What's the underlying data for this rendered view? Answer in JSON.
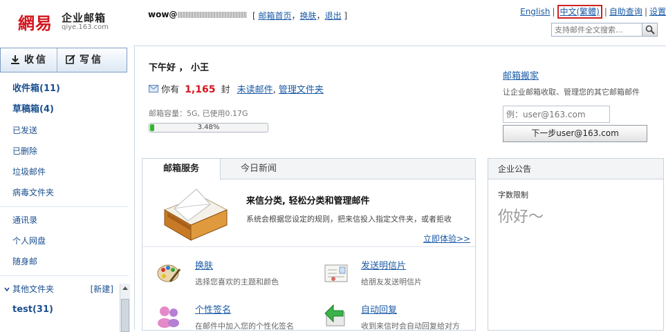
{
  "header": {
    "logo_mark": "網易",
    "logo_title": "企业邮箱",
    "logo_domain": "qiye.163.com",
    "user_prefix": "wow@",
    "top_links": [
      "邮箱首页",
      "换肤",
      "退出"
    ],
    "right_links": {
      "english": "English",
      "traditional": "中文(繁體)",
      "self_help": "自助查询",
      "settings": "设置"
    },
    "search_placeholder": "支持邮件全文搜索..."
  },
  "sidebar": {
    "receive_label": "收信",
    "write_label": "写信",
    "folders": [
      "收件箱(11)",
      "草稿箱(4)",
      "已发送",
      "已删除",
      "垃圾邮件",
      "病毒文件夹"
    ],
    "tools": [
      "通讯录",
      "个人网盘",
      "随身邮"
    ],
    "other_folders_label": "其他文件夹",
    "new_folder_label": "[新建]",
    "custom_folders": [
      "test(31)"
    ]
  },
  "main": {
    "greeting": "下午好 ， 小王",
    "unread_prefix": "你有",
    "unread_count": "1,165",
    "unread_unit": "封",
    "unread_link": "未读邮件",
    "manage_link": "管理文件夹",
    "storage_label": "邮箱容量：5G, 已使用0.17G",
    "storage_percent_text": "3.48%",
    "storage_fraction": 0.0348
  },
  "migration": {
    "title": "邮箱搬家",
    "desc": "让企业邮箱收取、管理您的其它邮箱邮件",
    "input_placeholder": "例：user@163.com",
    "next_button": "下一步user@163.com"
  },
  "service_panel": {
    "tabs": [
      "邮箱服务",
      "今日新闻"
    ],
    "feature_title": "来信分类, 轻松分类和管理邮件",
    "feature_desc": "系统会根据您设定的规则，把来信投入指定文件夹，或者拒收",
    "feature_link": "立即体验>>",
    "items": [
      {
        "title": "换肤",
        "desc": "选择您喜欢的主题和颜色",
        "icon": "palette-icon"
      },
      {
        "title": "发送明信片",
        "desc": "给朋友发送明信片",
        "icon": "postcard-icon"
      },
      {
        "title": "个性签名",
        "desc": "在邮件中加入您的个性化签名",
        "icon": "signature-icon"
      },
      {
        "title": "自动回复",
        "desc": "收到来信时会自动回复给对方",
        "icon": "auto-reply-icon"
      }
    ]
  },
  "notice_panel": {
    "title": "企业公告",
    "subtitle": "字数限制",
    "text": "你好～"
  },
  "colors": {
    "brand_red": "#d5151d",
    "link_blue": "#1a5aa6",
    "progress_green": "#35b335"
  }
}
